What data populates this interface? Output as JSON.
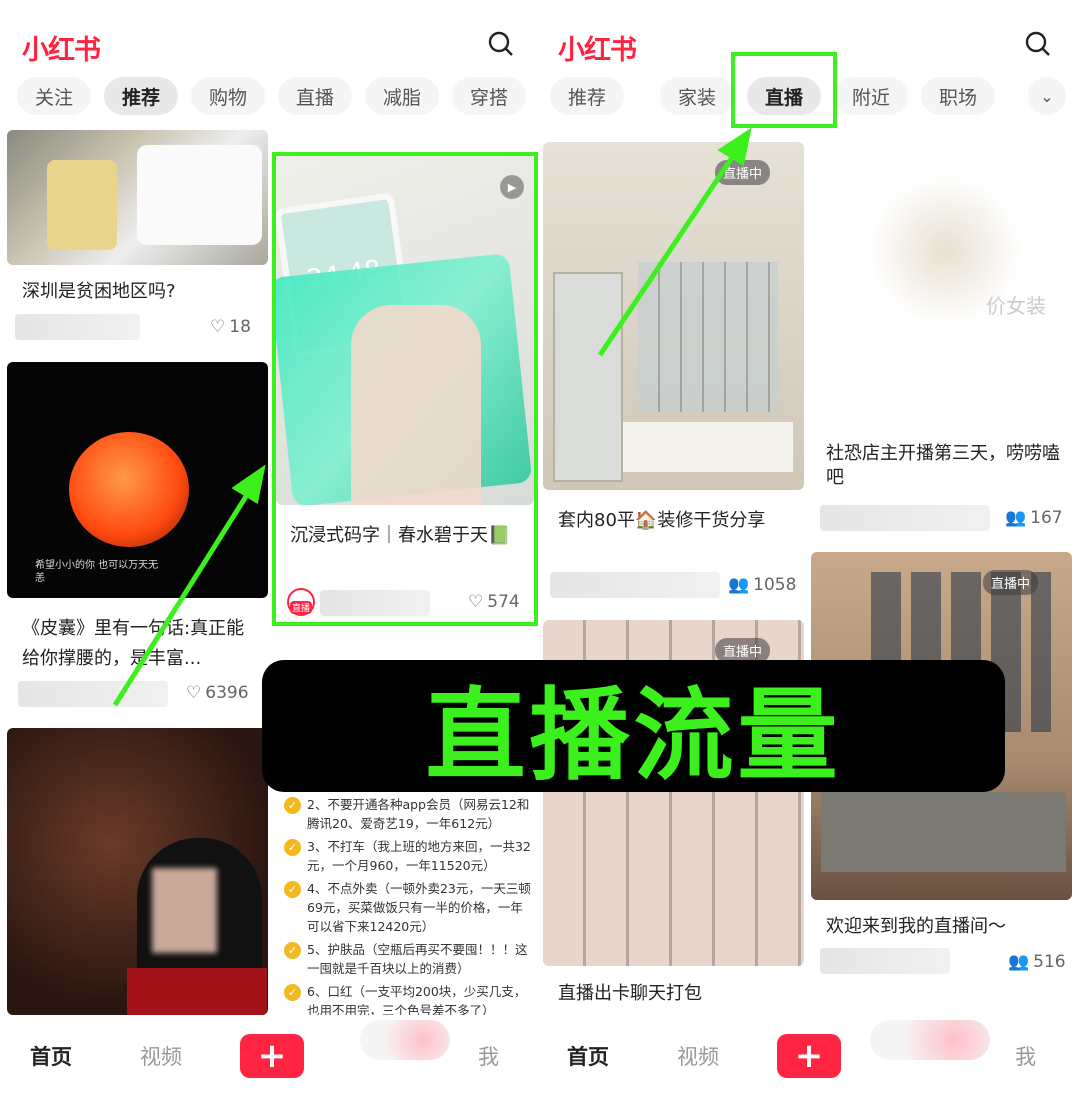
{
  "left": {
    "logo": "小红书",
    "tabs": [
      "关注",
      "推荐",
      "购物",
      "直播",
      "减脂",
      "穿搭"
    ],
    "active_tab": "推荐",
    "cards": [
      {
        "title": "深圳是贫困地区吗?",
        "likes": "18"
      },
      {
        "title": "《皮囊》里有一句话:真正能给你撑腰的，是丰富...",
        "likes": "6396",
        "image_text": "希望小小的你 也可以万天无恙"
      },
      {
        "title": "沉浸式码字｜春水碧于天📗",
        "likes": "574",
        "avatar_badge": "直播",
        "image_text": "24 48"
      }
    ],
    "list_items": [
      "2、不要开通各种app会员（网易云12和腾讯20、爱奇艺19，一年612元）",
      "3、不打车（我上班的地方来回，一共32元，一个月960，一年11520元）",
      "4、不点外卖（一顿外卖23元，一天三顿69元，买菜做饭只有一半的价格，一年可以省下来12420元）",
      "5、护肤品（空瓶后再买不要囤！！！这一囤就是千百块以上的消费）",
      "6、口红（一支平均200块，少买几支，也用不用完，三个色号差不多了）"
    ],
    "nav": {
      "home": "首页",
      "video": "视频",
      "plus": "+",
      "me": "我"
    }
  },
  "right": {
    "logo": "小红书",
    "tabs": [
      "推荐",
      "家装",
      "直播",
      "附近",
      "职场"
    ],
    "active_tab": "直播",
    "cards": [
      {
        "title": "套内80平🏠装修干货分享",
        "viewers": "1058",
        "badge": "直播中"
      },
      {
        "title": "社恐店主开播第三天，唠唠嗑吧",
        "viewers": "167",
        "image_text": "价女装"
      },
      {
        "title": "直播出卡聊天打包",
        "badge": "直播中"
      },
      {
        "title": "欢迎来到我的直播间～",
        "viewers": "516",
        "badge": "直播中"
      }
    ],
    "nav": {
      "home": "首页",
      "video": "视频",
      "plus": "+",
      "me": "我"
    }
  },
  "overlay": {
    "text": "直播流量",
    "color": "#3cf01e"
  },
  "colors": {
    "brand": "#ff2442",
    "highlight": "#3cf01e"
  }
}
